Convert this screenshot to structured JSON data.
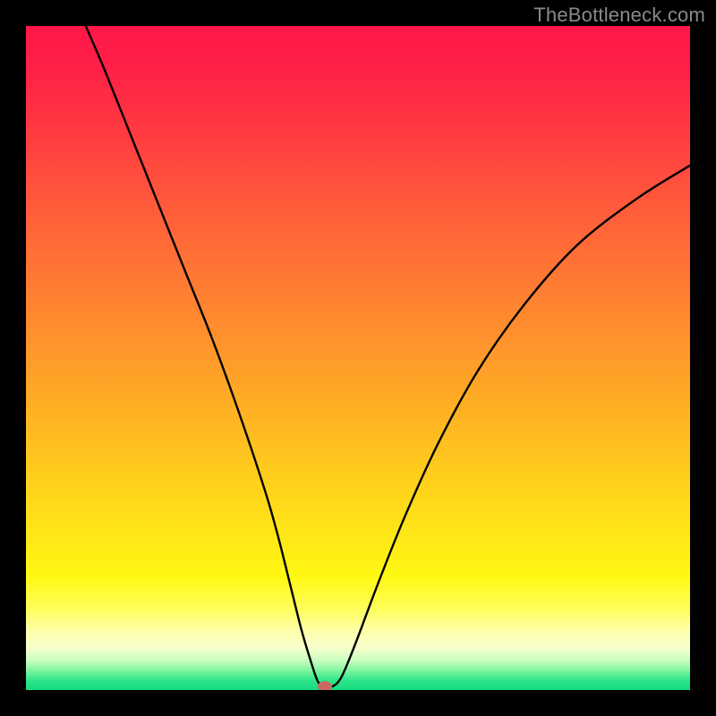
{
  "watermark": "TheBottleneck.com",
  "colors": {
    "frame": "#000000",
    "dot": "#c96a62",
    "curve": "#000000",
    "gradient_top": "#ff1848",
    "gradient_bottom": "#16d980"
  },
  "chart_data": {
    "type": "line",
    "title": "",
    "xlabel": "",
    "ylabel": "",
    "xlim": [
      0,
      100
    ],
    "ylim": [
      0,
      100
    ],
    "note": "x is horizontal position (0 left – 100 right); y is bottleneck percentage (0 bottom/green – 100 top/red). Curve plunges from top-left to a minimum near x≈45 then rises again.",
    "series": [
      {
        "name": "bottleneck-curve",
        "x": [
          9,
          12,
          16,
          20,
          24,
          28,
          32,
          36,
          38,
          40,
          41.5,
          43,
          44,
          45,
          46,
          47,
          48,
          50,
          53,
          57,
          62,
          68,
          75,
          83,
          92,
          100
        ],
        "y": [
          100,
          93,
          83,
          73,
          63,
          53,
          42,
          30,
          23,
          15,
          9,
          4,
          1.2,
          0.5,
          0.5,
          1.2,
          3,
          8,
          16,
          26,
          37,
          48,
          58,
          67,
          74,
          79
        ]
      }
    ],
    "marker": {
      "x": 45,
      "y": 0.5
    },
    "background_gradient": "vertical rainbow red→orange→yellow→green indicating bottleneck severity"
  }
}
